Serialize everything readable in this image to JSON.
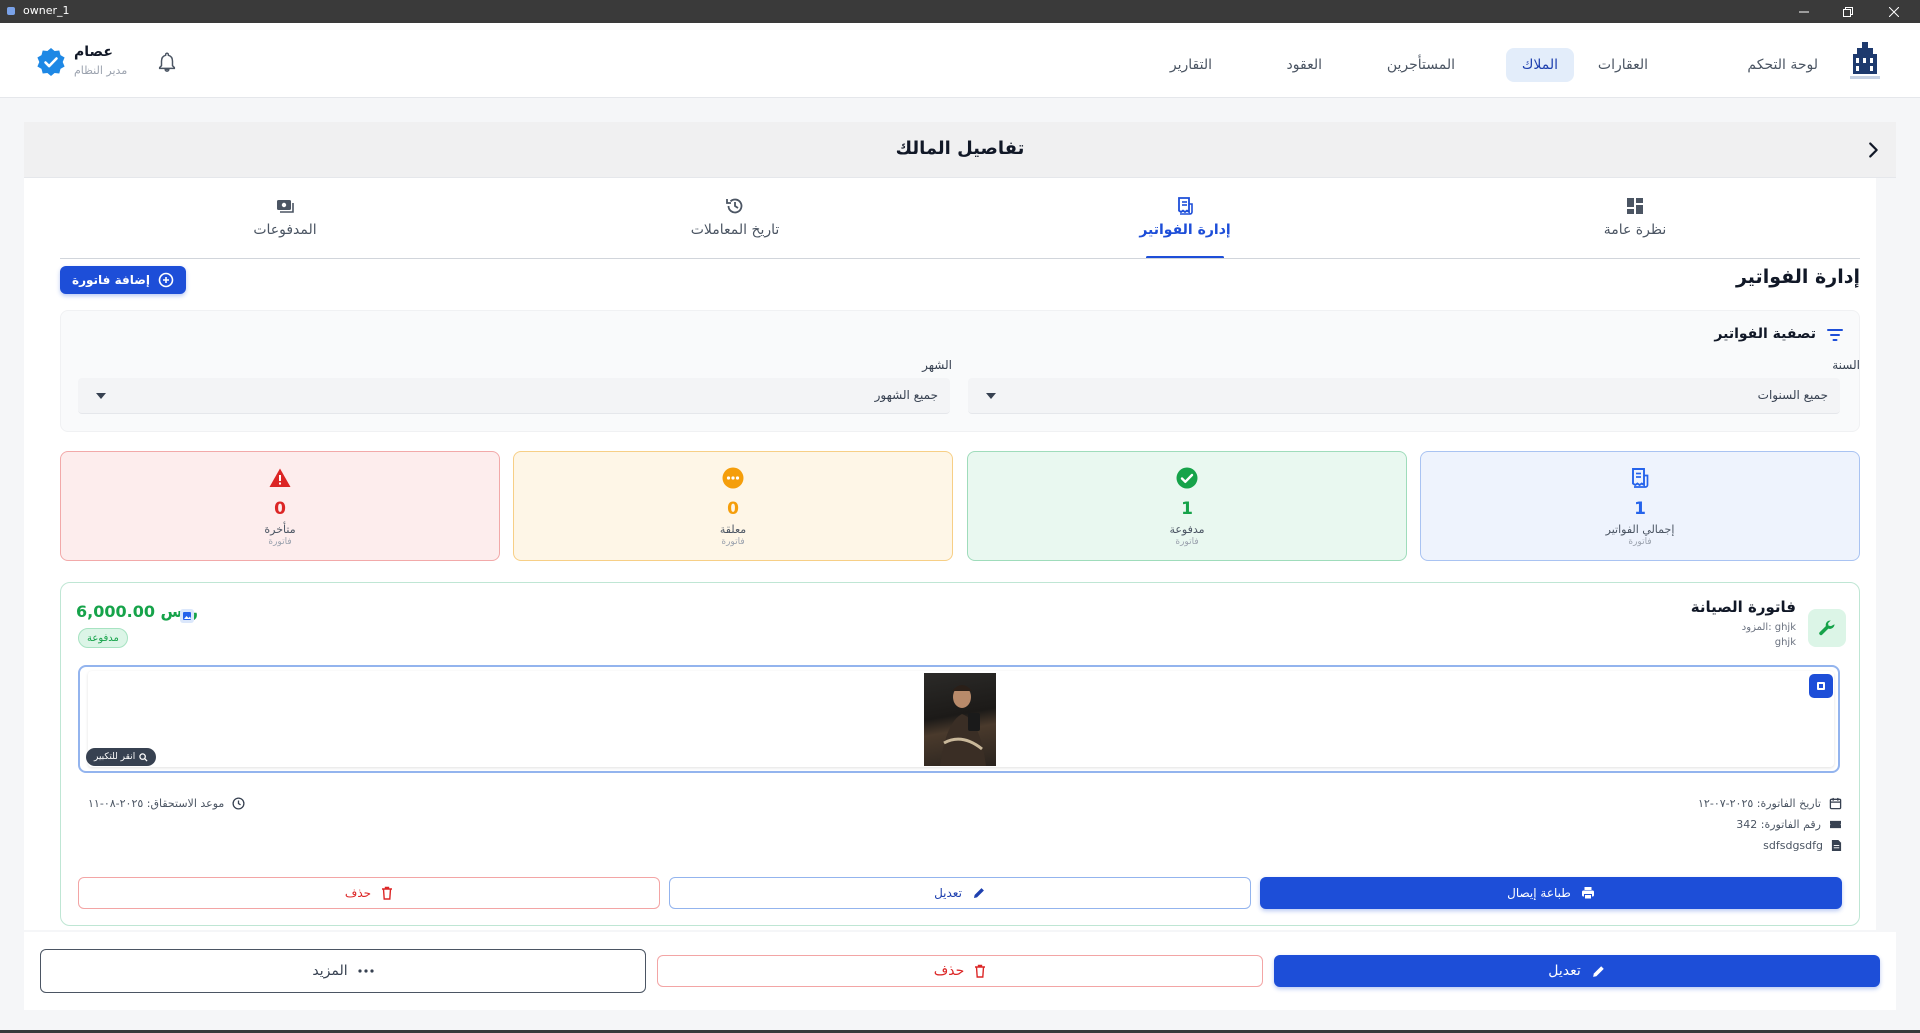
{
  "window": {
    "title": "owner_1"
  },
  "nav": {
    "items": [
      {
        "label": "لوحة التحكم",
        "active": false
      },
      {
        "label": "العقارات",
        "active": false
      },
      {
        "label": "الملاك",
        "active": true
      },
      {
        "label": "المستأجرين",
        "active": false
      },
      {
        "label": "العقود",
        "active": false
      },
      {
        "label": "التقارير",
        "active": false
      }
    ],
    "user": {
      "name": "عصام",
      "role": "مدير النظام"
    }
  },
  "page": {
    "title": "تفاصيل المالك"
  },
  "tabs": [
    {
      "label": "نظرة عامة",
      "icon": "dashboard-icon",
      "active": false
    },
    {
      "label": "إدارة الفواتير",
      "icon": "receipt-icon",
      "active": true
    },
    {
      "label": "تاريخ المعاملات",
      "icon": "history-icon",
      "active": false
    },
    {
      "label": "المدفوعات",
      "icon": "payments-icon",
      "active": false
    }
  ],
  "invoices": {
    "title": "إدارة الفواتير",
    "add_label": "إضافة فاتورة",
    "filter": {
      "title": "تصفية الفواتير",
      "year_label": "السنة",
      "year_value": "جميع السنوات",
      "month_label": "الشهر",
      "month_value": "جميع الشهور"
    },
    "stats": [
      {
        "value": "1",
        "label": "إجمالي الفواتير",
        "sub": "فاتورة",
        "color": "#2563eb"
      },
      {
        "value": "1",
        "label": "مدفوعة",
        "sub": "فاتورة",
        "color": "#16a34a"
      },
      {
        "value": "0",
        "label": "معلقة",
        "sub": "فاتورة",
        "color": "#f59e0b"
      },
      {
        "value": "0",
        "label": "متأخرة",
        "sub": "فاتورة",
        "color": "#dc2626"
      }
    ],
    "item": {
      "title": "فاتورة الصيانة",
      "vendor": "المزود: ghjk",
      "vendor_detail": "ghjk",
      "amount": "6,000.00 ر.س",
      "status": "مدفوعة",
      "zoom_label": "انقر للتكبير",
      "invoice_date": "تاريخ الفاتورة: ٢٠٢٥-٠٧-١٢",
      "invoice_number": "رقم الفاتورة: 342",
      "description": "sdfsdgsdfg",
      "due_date": "موعد الاستحقاق: ٢٠٢٥-٠٨-١١",
      "print_label": "طباعة إيصال",
      "edit_label": "تعديل",
      "delete_label": "حذف"
    }
  },
  "footer": {
    "edit_label": "تعديل",
    "delete_label": "حذف",
    "more_label": "المزيد"
  },
  "colors": {
    "primary": "#1d4ed8",
    "success": "#16a34a",
    "warning": "#f59e0b",
    "danger": "#dc2626"
  }
}
